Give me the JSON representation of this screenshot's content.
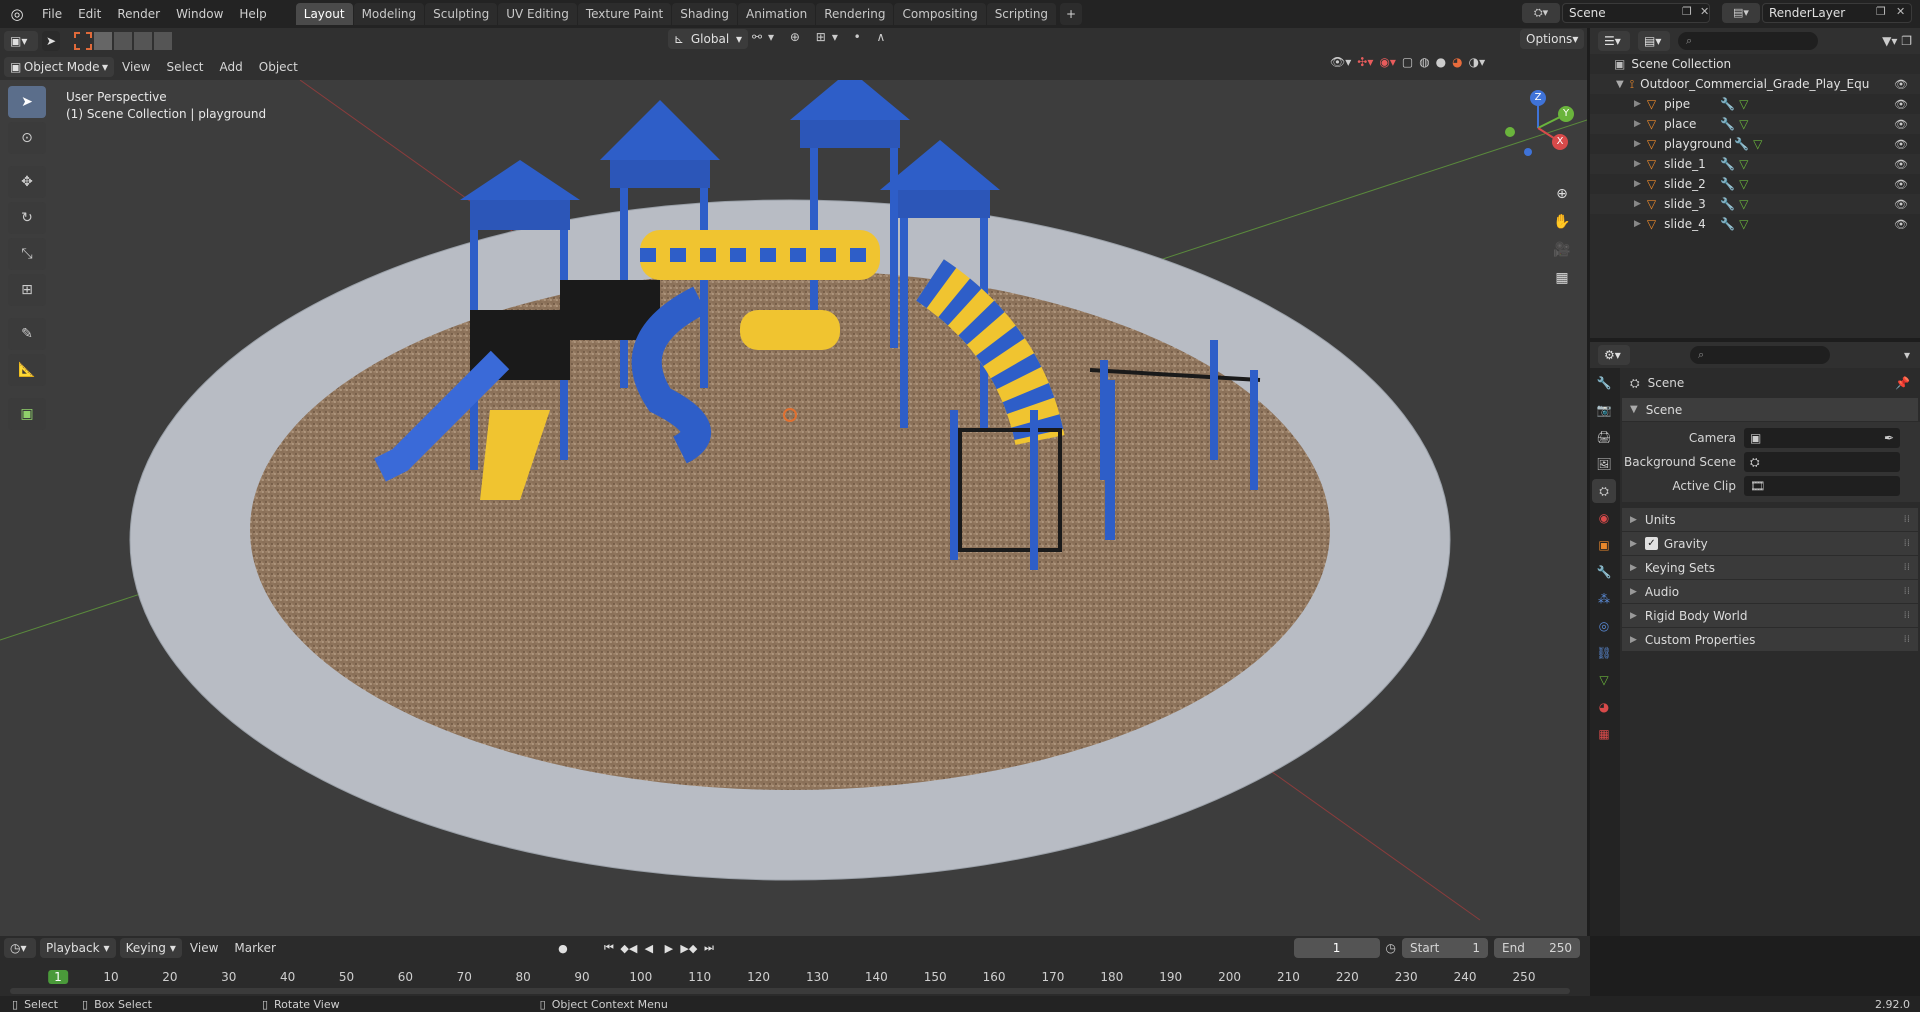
{
  "menu": [
    "File",
    "Edit",
    "Render",
    "Window",
    "Help"
  ],
  "workspaces": [
    {
      "label": "Layout",
      "active": true
    },
    {
      "label": "Modeling",
      "active": false
    },
    {
      "label": "Sculpting",
      "active": false
    },
    {
      "label": "UV Editing",
      "active": false
    },
    {
      "label": "Texture Paint",
      "active": false
    },
    {
      "label": "Shading",
      "active": false
    },
    {
      "label": "Animation",
      "active": false
    },
    {
      "label": "Rendering",
      "active": false
    },
    {
      "label": "Compositing",
      "active": false
    },
    {
      "label": "Scripting",
      "active": false
    }
  ],
  "workspace_add": "+",
  "scene_field": "Scene",
  "renderlayer_field": "RenderLayer",
  "viewport_header": {
    "mode": "Object Mode",
    "menus": [
      "View",
      "Select",
      "Add",
      "Object"
    ],
    "transform": "Global",
    "options": "Options"
  },
  "viewport_overlay": {
    "line1": "User Perspective",
    "line2": "(1) Scene Collection | playground"
  },
  "gizmo": {
    "z": "Z",
    "y": "Y",
    "x": "X"
  },
  "outliner": {
    "root": "Scene Collection",
    "collection": "Outdoor_Commercial_Grade_Play_Equipmer",
    "objects": [
      "pipe",
      "place",
      "playground",
      "slide_1",
      "slide_2",
      "slide_3",
      "slide_4"
    ]
  },
  "properties": {
    "header": "Scene",
    "panel": "Scene",
    "fields": [
      {
        "label": "Camera"
      },
      {
        "label": "Background Scene"
      },
      {
        "label": "Active Clip"
      }
    ],
    "subpanels": [
      "Units",
      "Gravity",
      "Keying Sets",
      "Audio",
      "Rigid Body World",
      "Custom Properties"
    ]
  },
  "timeline": {
    "menus": [
      "Playback",
      "Keying",
      "View",
      "Marker"
    ],
    "current_frame": "1",
    "start_label": "Start",
    "start": "1",
    "end_label": "End",
    "end": "250",
    "ticks": [
      "1",
      "10",
      "20",
      "30",
      "40",
      "50",
      "60",
      "70",
      "80",
      "90",
      "100",
      "110",
      "120",
      "130",
      "140",
      "150",
      "160",
      "170",
      "180",
      "190",
      "200",
      "210",
      "220",
      "230",
      "240",
      "250"
    ]
  },
  "statusbar": {
    "select": "Select",
    "box_select": "Box Select",
    "rotate_view": "Rotate View",
    "context_menu": "Object Context Menu",
    "version": "2.92.0"
  },
  "colors": {
    "accent": "#4772b3",
    "orange": "#e8872b",
    "viewport_bg": "#3d3d3d",
    "panel": "#2b2b2b"
  }
}
